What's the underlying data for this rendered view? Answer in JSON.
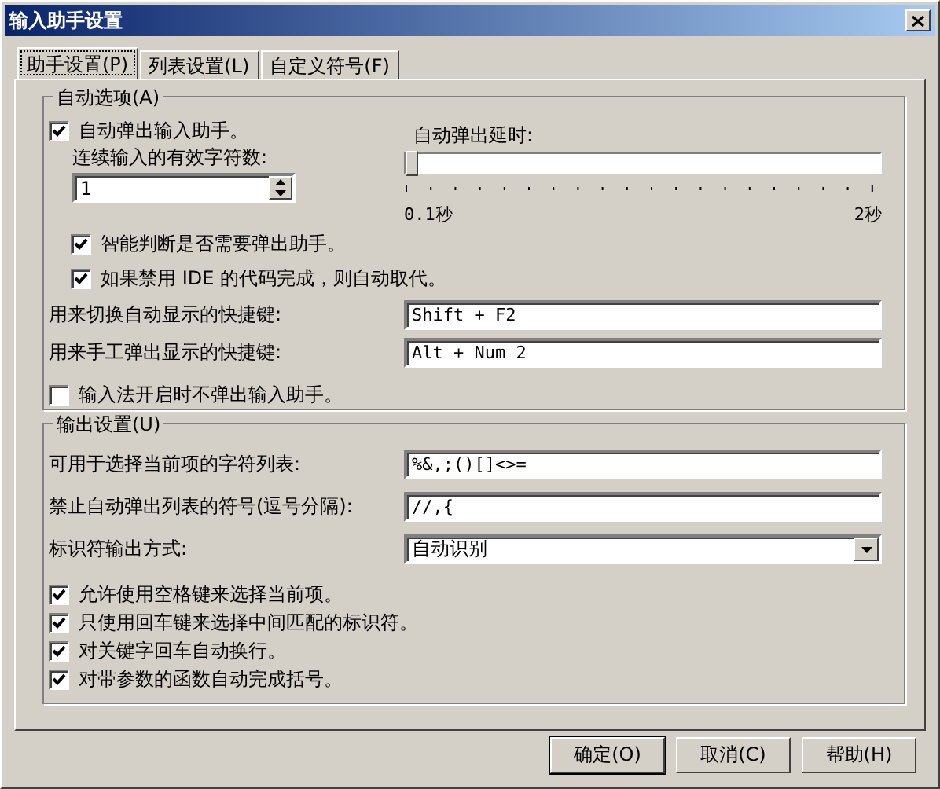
{
  "window": {
    "title": "输入助手设置"
  },
  "tabs": [
    {
      "label": "助手设置(P)",
      "selected": true
    },
    {
      "label": "列表设置(L)",
      "selected": false
    },
    {
      "label": "自定义符号(F)",
      "selected": false
    }
  ],
  "auto_group": {
    "title": "自动选项(A)",
    "auto_popup": {
      "label": "自动弹出输入助手。",
      "checked": true
    },
    "count_label": "连续输入的有效字符数:",
    "count_value": "1",
    "delay_label": "自动弹出延时:",
    "delay_slider": {
      "level": 0,
      "min_label": "0.1秒",
      "max_label": "2秒"
    },
    "sub_checks": [
      {
        "label": "智能判断是否需要弹出助手。",
        "checked": true
      },
      {
        "label": "如果禁用 IDE 的代码完成，则自动取代。",
        "checked": true
      }
    ],
    "shortcuts": [
      {
        "label": "用来切换自动显示的快捷键:",
        "value": "Shift + F2"
      },
      {
        "label": "用来手工弹出显示的快捷键:",
        "value": "Alt + Num 2"
      }
    ],
    "ime_check": {
      "label": "输入法开启时不弹出输入助手。",
      "checked": false
    }
  },
  "output_group": {
    "title": "输出设置(U)",
    "fields": [
      {
        "kind": "text",
        "label": "可用于选择当前项的字符列表:",
        "value": "%&,;()[]<>="
      },
      {
        "kind": "text",
        "label": "禁止自动弹出列表的符号(逗号分隔):",
        "value": "//,{"
      },
      {
        "kind": "dropdown",
        "label": "标识符输出方式:",
        "value": "自动识别"
      }
    ],
    "checks": [
      {
        "label": "允许使用空格键来选择当前项。",
        "checked": true
      },
      {
        "label": "只使用回车键来选择中间匹配的标识符。",
        "checked": true
      },
      {
        "label": "对关键字回车自动换行。",
        "checked": true
      },
      {
        "label": "对带参数的函数自动完成括号。",
        "checked": true
      }
    ]
  },
  "buttons": [
    {
      "label": "确定(O)",
      "default": true
    },
    {
      "label": "取消(C)",
      "default": false
    },
    {
      "label": "帮助(H)",
      "default": false
    }
  ]
}
